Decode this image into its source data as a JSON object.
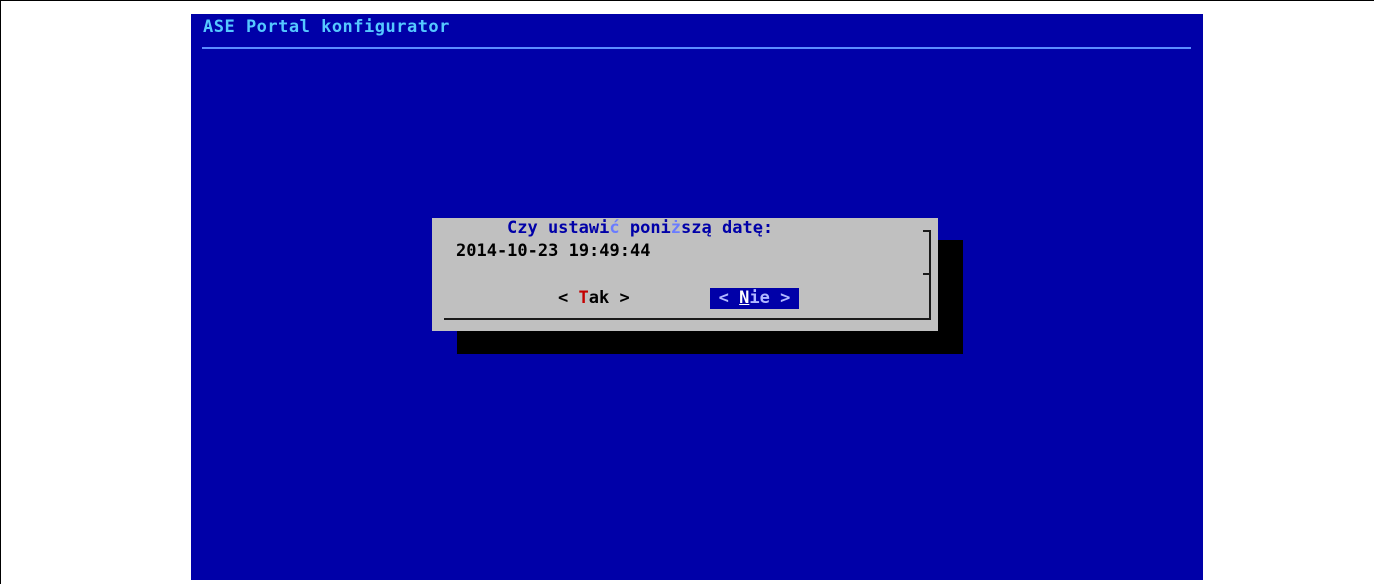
{
  "backtitle": "ASE Portal konfigurator",
  "dialog": {
    "prompt_parts": [
      "Czy ustawi",
      "ć",
      " poni",
      "ż",
      "szą datę:"
    ],
    "datetime": "2014-10-23 19:49:44"
  },
  "buttons": {
    "yes": {
      "open": "< ",
      "hotkey": "T",
      "rest": "ak",
      "close": " >"
    },
    "no": {
      "open": "< ",
      "hotkey": "N",
      "rest": "ie",
      "close": " >",
      "selected": true
    }
  },
  "colors": {
    "console_bg": "#0000a8",
    "dialog_bg": "#c0c0c0",
    "backtitle": "#55c8ff",
    "hotkey_red": "#c40000",
    "selected_button_bg": "#0000a8"
  }
}
